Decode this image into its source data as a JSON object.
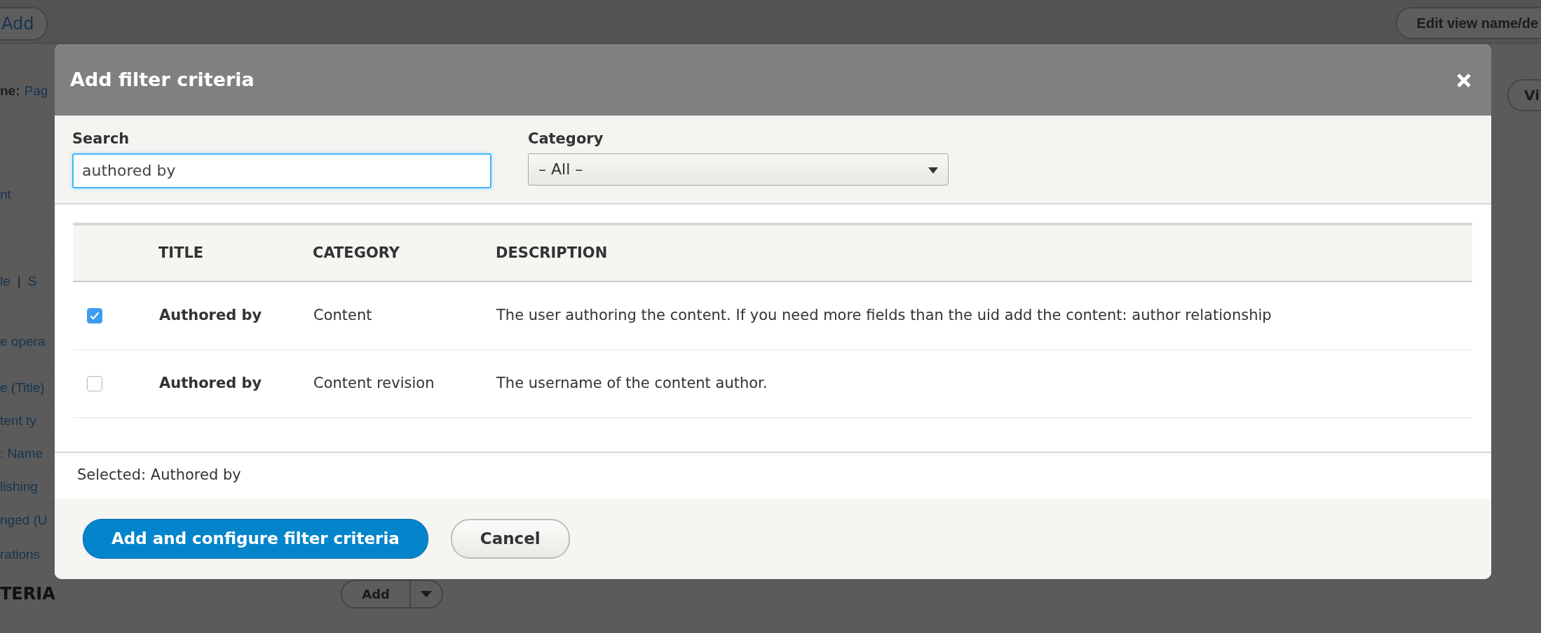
{
  "page": {
    "add_button": "Add",
    "edit_button": "Edit view name/de",
    "view_button": "Vi",
    "left_items": [
      {
        "kind": "label_link",
        "label": "ne:",
        "text": "Pag"
      },
      {
        "kind": "link",
        "text": "nt"
      },
      {
        "kind": "link_pair",
        "text": "le",
        "separator": "|",
        "text2": "S"
      },
      {
        "kind": "link",
        "text": "e opera"
      },
      {
        "kind": "link",
        "text": "e (Title)"
      },
      {
        "kind": "link",
        "text": "tent ty"
      },
      {
        "kind": "link",
        "text": ": Name"
      },
      {
        "kind": "link",
        "text": "lishing"
      },
      {
        "kind": "link",
        "text": "nged (U"
      },
      {
        "kind": "link",
        "text": "rations"
      }
    ],
    "section_title": "TERIA",
    "section_add": "Add"
  },
  "dialog": {
    "title": "Add filter criteria",
    "search": {
      "label": "Search",
      "value": "authored by"
    },
    "category": {
      "label": "Category",
      "value": "– All –"
    },
    "table": {
      "columns": [
        "TITLE",
        "CATEGORY",
        "DESCRIPTION"
      ],
      "rows": [
        {
          "checked": true,
          "title": "Authored by",
          "category": "Content",
          "description": "The user authoring the content. If you need more fields than the uid add the content: author relationship"
        },
        {
          "checked": false,
          "title": "Authored by",
          "category": "Content revision",
          "description": "The username of the content author."
        }
      ]
    },
    "selected_text": "Selected: Authored by",
    "buttons": [
      {
        "kind": "primary",
        "label": "Add and configure filter criteria"
      },
      {
        "kind": "secondary",
        "label": "Cancel"
      }
    ]
  }
}
